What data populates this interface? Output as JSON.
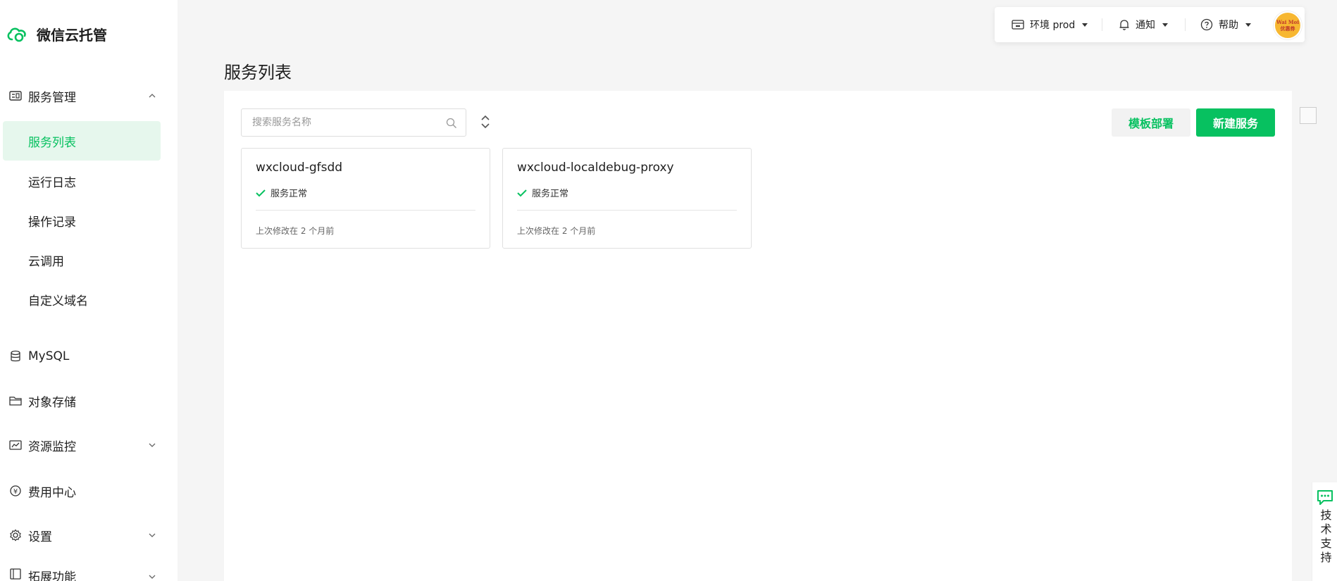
{
  "app": {
    "title": "微信云托管",
    "accent": "#07c160"
  },
  "sidebar": {
    "groups": [
      {
        "label": "服务管理",
        "icon": "service-manage-icon",
        "expanded": true
      },
      {
        "label": "MySQL",
        "icon": "database-icon"
      },
      {
        "label": "对象存储",
        "icon": "folder-icon"
      },
      {
        "label": "资源监控",
        "icon": "monitor-chart-icon"
      },
      {
        "label": "费用中心",
        "icon": "yen-icon"
      },
      {
        "label": "设置",
        "icon": "gear-icon"
      },
      {
        "label": "拓展功能",
        "icon": "extension-icon"
      }
    ],
    "sub_items": [
      {
        "label": "服务列表",
        "active": true
      },
      {
        "label": "运行日志"
      },
      {
        "label": "操作记录"
      },
      {
        "label": "云调用"
      },
      {
        "label": "自定义域名"
      }
    ]
  },
  "header": {
    "env_label": "环境 prod",
    "notify_label": "通知",
    "help_label": "帮助",
    "avatar_text_line1": "Wai Moi",
    "avatar_text_line2": "优惠券"
  },
  "page": {
    "title": "服务列表"
  },
  "toolbar": {
    "search_placeholder": "搜索服务名称",
    "template_deploy_label": "模板部署",
    "new_service_label": "新建服务"
  },
  "services": [
    {
      "name": "wxcloud-gfsdd",
      "status": "服务正常",
      "modified": "上次修改在 2 个月前"
    },
    {
      "name": "wxcloud-localdebug-proxy",
      "status": "服务正常",
      "modified": "上次修改在 2 个月前"
    }
  ],
  "support": {
    "label": "技术支持"
  }
}
